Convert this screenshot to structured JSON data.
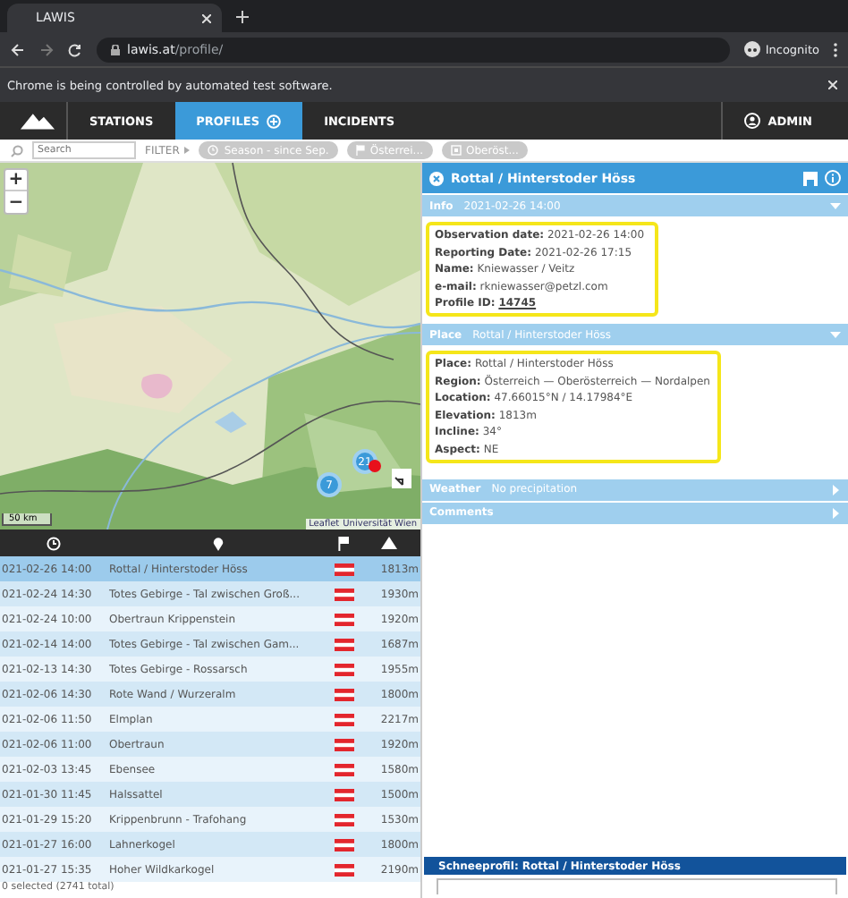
{
  "browser": {
    "tab_title": "LAWIS",
    "url_host": "lawis.at",
    "url_path": "/profile/",
    "profile": "Incognito",
    "infobar": "Chrome is being controlled by automated test software."
  },
  "nav": {
    "items": [
      {
        "label": "STATIONS",
        "selected": false
      },
      {
        "label": "PROFILES",
        "selected": true
      },
      {
        "label": "INCIDENTS",
        "selected": false
      }
    ],
    "admin": "ADMIN"
  },
  "filter": {
    "placeholder": "Search",
    "label": "FILTER",
    "chips": [
      {
        "kind": "season",
        "label": "Season - since Sep."
      },
      {
        "kind": "country",
        "label": "Österrei..."
      },
      {
        "kind": "region",
        "label": "Oberöst..."
      }
    ]
  },
  "map": {
    "zoom_in": "+",
    "zoom_out": "−",
    "clusters": [
      {
        "count": "7"
      },
      {
        "count": "21"
      }
    ],
    "scale": "50 km",
    "attribution": [
      "Leaflet",
      "Universität Wien"
    ]
  },
  "table": {
    "rows": [
      {
        "date": "021-02-26 14:00",
        "place": "Rottal / Hinterstoder Höss",
        "elevation": "1813m",
        "selected": true
      },
      {
        "date": "021-02-24 14:30",
        "place": "Totes Gebirge - Tal zwischen Groß...",
        "elevation": "1930m",
        "selected": false
      },
      {
        "date": "021-02-24 10:00",
        "place": "Obertraun Krippenstein",
        "elevation": "1920m",
        "selected": false
      },
      {
        "date": "021-02-14 14:00",
        "place": "Totes Gebirge - Tal zwischen Gam...",
        "elevation": "1687m",
        "selected": false
      },
      {
        "date": "021-02-13 14:30",
        "place": "Totes Gebirge - Rossarsch",
        "elevation": "1955m",
        "selected": false
      },
      {
        "date": "021-02-06 14:30",
        "place": "Rote Wand / Wurzeralm",
        "elevation": "1800m",
        "selected": false
      },
      {
        "date": "021-02-06 11:50",
        "place": "Elmplan",
        "elevation": "2217m",
        "selected": false
      },
      {
        "date": "021-02-06 11:00",
        "place": "Obertraun",
        "elevation": "1920m",
        "selected": false
      },
      {
        "date": "021-02-03 13:45",
        "place": "Ebensee",
        "elevation": "1580m",
        "selected": false
      },
      {
        "date": "021-01-30 11:45",
        "place": "Halssattel",
        "elevation": "1500m",
        "selected": false
      },
      {
        "date": "021-01-29 15:20",
        "place": "Krippenbrunn - Trafohang",
        "elevation": "1530m",
        "selected": false
      },
      {
        "date": "021-01-27 16:00",
        "place": "Lahnerkogel",
        "elevation": "1800m",
        "selected": false
      },
      {
        "date": "021-01-27 15:35",
        "place": "Hoher Wildkarkogel",
        "elevation": "2190m",
        "selected": false
      }
    ],
    "status": "0 selected (2741 total)"
  },
  "detail": {
    "title": "Rottal / Hinterstoder Höss",
    "sections": [
      {
        "heading": "Info",
        "summary": "2021-02-26 14:00",
        "expanded": true,
        "highlighted": true,
        "fields": [
          {
            "label": "Observation date:",
            "value": "2021-02-26 14:00",
            "kind": "text"
          },
          {
            "label": "Reporting Date:",
            "value": "2021-02-26 17:15",
            "kind": "text"
          },
          {
            "label": "Name:",
            "value": "Kniewasser / Veitz",
            "kind": "text"
          },
          {
            "label": "e-mail:",
            "value": "rkniewasser@petzl.com",
            "kind": "text"
          },
          {
            "label": "Profile ID:",
            "value": "14745",
            "kind": "link"
          }
        ]
      },
      {
        "heading": "Place",
        "summary": "Rottal / Hinterstoder Höss",
        "expanded": true,
        "highlighted": true,
        "fields": [
          {
            "label": "Place:",
            "value": "Rottal / Hinterstoder Höss",
            "kind": "text"
          },
          {
            "label": "Region:",
            "value": "Österreich — Oberösterreich — Nordalpen",
            "kind": "text"
          },
          {
            "label": "Location:",
            "value": "47.66015°N / 14.17984°E",
            "kind": "text"
          },
          {
            "label": "Elevation:",
            "value": "1813m",
            "kind": "text"
          },
          {
            "label": "Incline:",
            "value": "34°",
            "kind": "text"
          },
          {
            "label": "Aspect:",
            "value": "NE",
            "kind": "text"
          }
        ]
      },
      {
        "heading": "Weather",
        "summary": "No precipitation",
        "expanded": false
      },
      {
        "heading": "Comments",
        "expanded": false
      }
    ],
    "snow_profile": "Schneeprofil: Rottal / Hinterstoder Höss"
  }
}
